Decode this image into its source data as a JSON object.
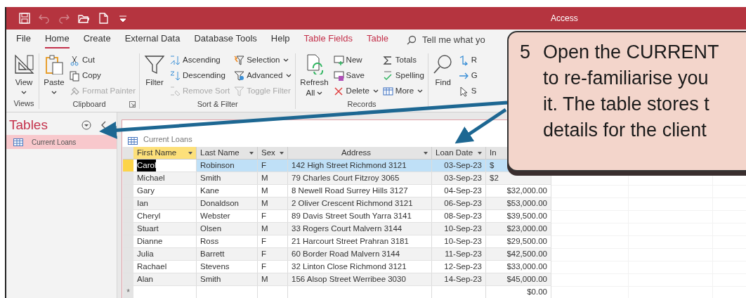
{
  "window": {
    "title": "Access"
  },
  "quick_access": [
    {
      "kind": "save",
      "disabled": false
    },
    {
      "kind": "undo",
      "disabled": true
    },
    {
      "kind": "redo",
      "disabled": true
    },
    {
      "kind": "open",
      "disabled": false
    },
    {
      "kind": "new",
      "disabled": false
    },
    {
      "kind": "customize",
      "disabled": false
    }
  ],
  "tabs": [
    {
      "label": "File",
      "selected": false,
      "kind": "main"
    },
    {
      "label": "Home",
      "selected": true,
      "kind": "main"
    },
    {
      "label": "Create",
      "selected": false,
      "kind": "main"
    },
    {
      "label": "External Data",
      "selected": false,
      "kind": "main"
    },
    {
      "label": "Database Tools",
      "selected": false,
      "kind": "main"
    },
    {
      "label": "Help",
      "selected": false,
      "kind": "main"
    },
    {
      "label": "Table Fields",
      "selected": false,
      "kind": "context"
    },
    {
      "label": "Table",
      "selected": false,
      "kind": "context"
    }
  ],
  "search": {
    "placeholder": "Tell me what yo"
  },
  "ribbon": [
    {
      "label": "Views",
      "launcher": false,
      "columns": [
        [
          {
            "label": "View",
            "kind": "large",
            "dropdown": true,
            "disabled": false
          }
        ]
      ]
    },
    {
      "label": "Clipboard",
      "launcher": true,
      "columns": [
        [
          {
            "label": "Paste",
            "kind": "large",
            "dropdown": true,
            "disabled": false
          }
        ],
        [
          {
            "label": "Cut",
            "kind": "small",
            "dropdown": false,
            "disabled": false
          },
          {
            "label": "Copy",
            "kind": "small",
            "dropdown": false,
            "disabled": false
          },
          {
            "label": "Format Painter",
            "kind": "small",
            "dropdown": false,
            "disabled": true
          }
        ]
      ]
    },
    {
      "label": "Sort & Filter",
      "launcher": false,
      "columns": [
        [
          {
            "label": "Filter",
            "kind": "large",
            "dropdown": false,
            "disabled": false
          }
        ],
        [
          {
            "label": "Ascending",
            "kind": "small",
            "dropdown": false,
            "disabled": false
          },
          {
            "label": "Descending",
            "kind": "small",
            "dropdown": false,
            "disabled": false
          },
          {
            "label": "Remove Sort",
            "kind": "small",
            "dropdown": false,
            "disabled": true
          }
        ],
        [
          {
            "label": "Selection",
            "kind": "small",
            "dropdown": true,
            "disabled": false
          },
          {
            "label": "Advanced",
            "kind": "small",
            "dropdown": true,
            "disabled": false
          },
          {
            "label": "Toggle Filter",
            "kind": "small",
            "dropdown": false,
            "disabled": true
          }
        ]
      ]
    },
    {
      "label": "Records",
      "launcher": false,
      "columns": [
        [
          {
            "label": "Refresh",
            "label2": "All",
            "kind": "large",
            "dropdown": true,
            "disabled": false
          }
        ],
        [
          {
            "label": "New",
            "kind": "small",
            "dropdown": false,
            "disabled": false
          },
          {
            "label": "Save",
            "kind": "small",
            "dropdown": false,
            "disabled": false
          },
          {
            "label": "Delete",
            "kind": "small",
            "dropdown": true,
            "disabled": false
          }
        ],
        [
          {
            "label": "Totals",
            "kind": "small",
            "dropdown": false,
            "disabled": false
          },
          {
            "label": "Spelling",
            "kind": "small",
            "dropdown": false,
            "disabled": false
          },
          {
            "label": "More",
            "kind": "small",
            "dropdown": true,
            "disabled": false
          }
        ]
      ]
    },
    {
      "columns": [
        [
          {
            "label": "Find",
            "kind": "large",
            "dropdown": false,
            "disabled": false
          }
        ],
        [
          {
            "label": "R",
            "kind": "small",
            "dropdown": false,
            "disabled": false
          },
          {
            "label": "G",
            "kind": "small",
            "dropdown": false,
            "disabled": false
          },
          {
            "label": "S",
            "kind": "small",
            "dropdown": false,
            "disabled": false
          }
        ]
      ]
    }
  ],
  "nav_pane": {
    "title": "Tables",
    "items": [
      {
        "label": "Current Loans",
        "selected": true
      }
    ]
  },
  "document_tab": {
    "label": "Current Loans"
  },
  "table": {
    "columns": [
      {
        "label": "First Name",
        "selected": true
      },
      {
        "label": "Last Name",
        "selected": false
      },
      {
        "label": "Sex",
        "selected": false
      },
      {
        "label": "Address",
        "selected": false
      },
      {
        "label": "Loan Date",
        "selected": false
      },
      {
        "label": "In",
        "selected": false
      }
    ],
    "rows": [
      {
        "cells": [
          "Carol",
          "Robinson",
          "F",
          "142 High Street Richmond 3121",
          "03-Sep-23",
          "$"
        ],
        "selected": true,
        "partial": true
      },
      {
        "cells": [
          "Michael",
          "Smith",
          "M",
          "79 Charles Court Fitzroy 3065",
          "03-Sep-23",
          "$2"
        ],
        "selected": false,
        "partial": true
      },
      {
        "cells": [
          "Gary",
          "Kane",
          "M",
          "8 Newell Road Surrey Hills 3127",
          "04-Sep-23",
          "$32,000.00"
        ],
        "selected": false,
        "partial": false
      },
      {
        "cells": [
          "Ian",
          "Donaldson",
          "M",
          "2 Oliver Crescent Richmond 3121",
          "06-Sep-23",
          "$53,000.00"
        ],
        "selected": false,
        "partial": false
      },
      {
        "cells": [
          "Cheryl",
          "Webster",
          "F",
          "89 Davis Street South Yarra 3141",
          "08-Sep-23",
          "$39,500.00"
        ],
        "selected": false,
        "partial": false
      },
      {
        "cells": [
          "Stuart",
          "Olsen",
          "M",
          "33 Rogers Court Malvern 3144",
          "10-Sep-23",
          "$23,000.00"
        ],
        "selected": false,
        "partial": false
      },
      {
        "cells": [
          "Dianne",
          "Ross",
          "F",
          "21 Harcourt Street Prahran 3181",
          "10-Sep-23",
          "$29,500.00"
        ],
        "selected": false,
        "partial": false
      },
      {
        "cells": [
          "Julia",
          "Barrett",
          "F",
          "60 Border Road Malvern 3144",
          "11-Sep-23",
          "$42,500.00"
        ],
        "selected": false,
        "partial": false
      },
      {
        "cells": [
          "Rachael",
          "Stevens",
          "F",
          "32 Linton Close Richmond 3121",
          "12-Sep-23",
          "$33,000.00"
        ],
        "selected": false,
        "partial": false
      },
      {
        "cells": [
          "Alan",
          "Smith",
          "M",
          "156 Alsop Street Werribee 3030",
          "14-Sep-23",
          "$45,000.00"
        ],
        "selected": false,
        "partial": false
      }
    ],
    "new_row": {
      "marker": "*",
      "cells": [
        "",
        "",
        "",
        "",
        "",
        "$0.00"
      ]
    }
  },
  "callout": {
    "number": "5",
    "lines": [
      "Open the CURRENT",
      "to re-familiarise you",
      "it.  The table stores t",
      "details for the client"
    ]
  }
}
